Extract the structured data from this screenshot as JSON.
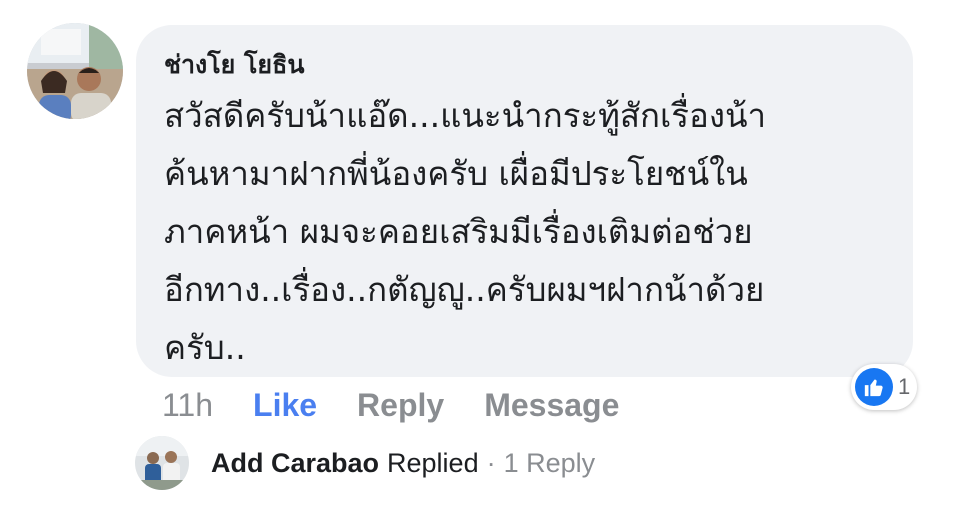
{
  "comment": {
    "author": "ช่างโย โยธิน",
    "text": "สวัสดีครับน้าแอ๊ด...แนะนำกระทู้สักเรื่องน้า\nค้นหามาฝากพี่น้องครับ เผื่อมีประโยชน์ใน\nภาคหน้า ผมจะคอยเสริมมีเรื่องเติมต่อช่วย\nอีกทาง..เรื่อง..กตัญญู..ครับผมฯฝากน้าด้วย\nครับ..",
    "timestamp": "11h",
    "like_label": "Like",
    "reply_label": "Reply",
    "message_label": "Message",
    "reaction_count": "1",
    "reaction_icon": "thumbs-up-icon"
  },
  "replies": {
    "author": "Add Carabao",
    "action": "Replied",
    "separator": "·",
    "count_label": "1 Reply"
  },
  "colors": {
    "bubble": "#f0f2f5",
    "like_active": "#4a7ff0",
    "muted": "#8a8d91",
    "text": "#1c1e21",
    "reaction_blue": "#1877f2"
  }
}
